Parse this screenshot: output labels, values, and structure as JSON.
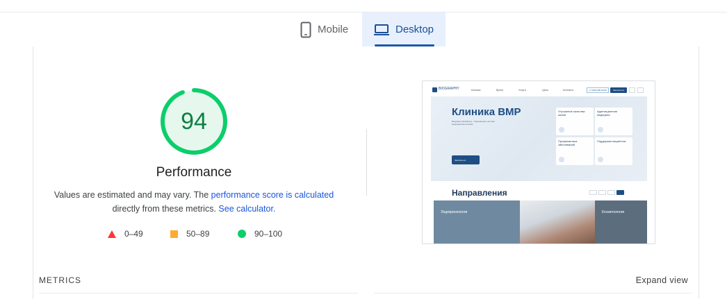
{
  "tabs": {
    "mobile_label": "Mobile",
    "desktop_label": "Desktop",
    "active": "Desktop"
  },
  "score": {
    "value": "94",
    "title": "Performance",
    "fraction": 0.94,
    "color": "#0cce6b"
  },
  "description": {
    "text_before": "Values are estimated and may vary. The",
    "link1": "performance score is calculated",
    "text_middle": "directly from these metrics.",
    "link2": "See calculator."
  },
  "legend": {
    "red": "0–49",
    "orange": "50–89",
    "green": "90–100"
  },
  "footer": {
    "metrics_label": "METRICS",
    "expand_label": "Expand view"
  },
  "thumbnail": {
    "logo": "BIOGRAPHY",
    "nav": [
      "Клиника",
      "Врачи",
      "Услуги",
      "Цены",
      "Контакты"
    ],
    "phone": "+7 (000) 000-00-00",
    "header_button": "Записаться",
    "hero_title": "Клиника BMP",
    "hero_subtitle": "Biography Well-Being - современная частная медицинская клиника",
    "hero_button": "Записаться",
    "cards": [
      "Улучшение качества жизни",
      "Адаптационная медицина",
      "Профилактика заболеваний",
      "Поддержка пациентов"
    ],
    "directions_title": "Направления",
    "tile_left": "Эндокринология",
    "tile_right": "Косметология"
  }
}
